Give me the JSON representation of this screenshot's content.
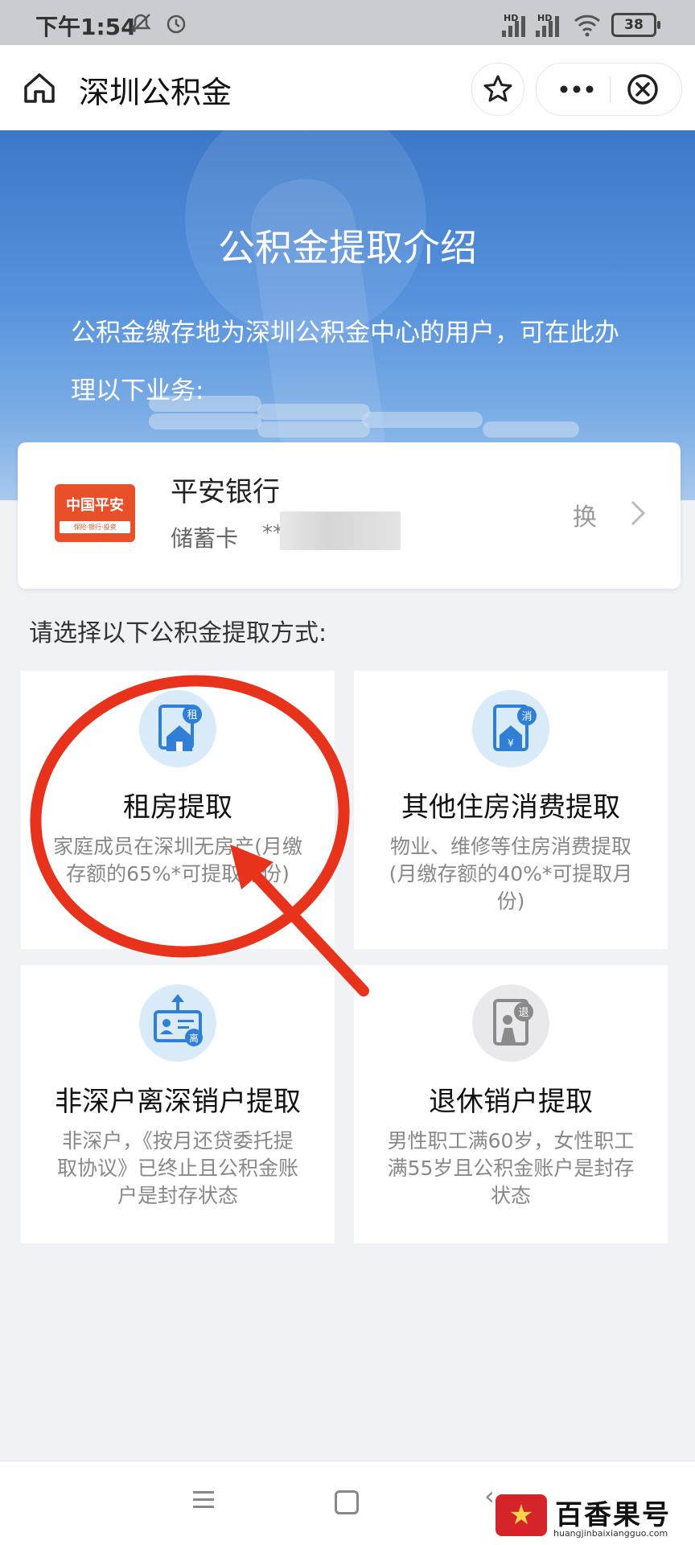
{
  "status_bar": {
    "time": "下午1:54",
    "network_1": "HD",
    "network_2": "HD",
    "battery": "38"
  },
  "title_bar": {
    "title": "深圳公积金",
    "icons": [
      "home-icon",
      "star-icon",
      "more-icon",
      "close-icon"
    ]
  },
  "banner": {
    "title": "公积金提取介绍",
    "description": "公积金缴存地为深圳公积金中心的用户，可在此办理以下业务:"
  },
  "bank_card": {
    "logo_text": "中国平安",
    "logo_subtext": "保险·银行·投资",
    "bank_name": "平安银行",
    "card_type": "储蓄卡",
    "card_number_prefix": "**",
    "change_label": "换"
  },
  "section_label": "请选择以下公积金提取方式:",
  "options": [
    {
      "name": "租房提取",
      "description": "家庭成员在深圳无房产(月缴存额的65%*可提取月份)",
      "icon": "rent-house-icon",
      "icon_badge": "租"
    },
    {
      "name": "其他住房消费提取",
      "description": "物业、维修等住房消费提取(月缴存额的40%*可提取月份)",
      "icon": "housing-consumption-icon",
      "icon_badge": "消"
    },
    {
      "name": "非深户离深销户提取",
      "description": "非深户，《按月还贷委托提取协议》已终止且公积金账户是封存状态",
      "icon": "leave-shenzhen-icon",
      "icon_badge": "离"
    },
    {
      "name": "退休销户提取",
      "description": "男性职工满60岁，女性职工满55岁且公积金账户是封存状态",
      "icon": "retirement-icon",
      "icon_badge": "退"
    }
  ],
  "watermark": {
    "text": "百香果号",
    "url": "huangjinbaixiangguo.com"
  },
  "colors": {
    "annotation": "#e8331c",
    "accent": "#3d78c8",
    "icon_bg": "#d9ebf9"
  }
}
